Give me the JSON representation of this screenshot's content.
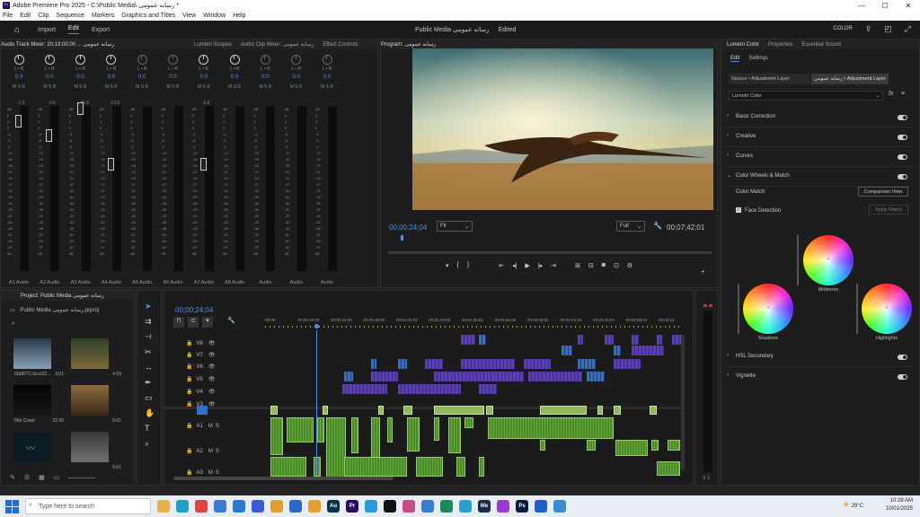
{
  "window": {
    "title": "Adobe Premiere Pro 2025 - C:\\Public Media\\ رسانه عمومی *",
    "controls": [
      "—",
      "☐",
      "✕"
    ]
  },
  "menu": [
    "File",
    "Edit",
    "Clip",
    "Sequence",
    "Markers",
    "Graphics and Titles",
    "View",
    "Window",
    "Help"
  ],
  "workspaces": {
    "import": "Import",
    "edit": "Edit",
    "export": "Export"
  },
  "project_title": "Public Media رسانه عمومی",
  "project_status": "Edited",
  "header_right": {
    "label": "COLOR"
  },
  "mixer": {
    "tabs": [
      "Audio Track Mixer: رسانه عمومی ... 00;00;13;20",
      "Lumetri Scopes",
      "Audio Clip Mixer: رسانه عمومی",
      "Effect Controls"
    ],
    "tracks": [
      {
        "label": "A1 Audio",
        "value": "0.0",
        "db": "-1.5"
      },
      {
        "label": "A2 Audio",
        "value": "0.0",
        "db": "-3.6"
      },
      {
        "label": "A3 Audio",
        "value": "0.0",
        "db": "-45.0"
      },
      {
        "label": "A4 Audio",
        "value": "0.0",
        "db": "-13.0"
      },
      {
        "label": "A5 Audio",
        "value": "0.0",
        "db": ""
      },
      {
        "label": "A6 Audio",
        "value": "0.0",
        "db": ""
      },
      {
        "label": "A7 Audio",
        "value": "0.0",
        "db": "-5.6"
      },
      {
        "label": "A8 Audio",
        "value": "0.0",
        "db": ""
      },
      {
        "label": "Audio",
        "value": "0.0",
        "db": ""
      },
      {
        "label": "Audio",
        "value": "0.0",
        "db": ""
      },
      {
        "label": "Audio",
        "value": "0.0",
        "db": ""
      }
    ],
    "scale": [
      "dB",
      "6",
      "3",
      "0",
      "-3",
      "-6",
      "-9",
      "-12",
      "-15",
      "-18",
      "-21",
      "-24",
      "-27",
      "-30",
      "-33",
      "-36",
      "-39",
      "-42",
      "-45",
      "-48",
      "-51",
      "-54",
      "-57",
      "dB"
    ]
  },
  "program": {
    "tab": "Program: رسانه عمومی",
    "current_time": "00;00;24;04",
    "fit": "Fit",
    "quality": "Full",
    "duration": "00;07;42;01"
  },
  "lumetri": {
    "tabs": [
      "Lumetri Color",
      "Properties",
      "Essential Sound"
    ],
    "subtabs": [
      "Edit",
      "Settings"
    ],
    "master": "Source • Adjustment Layer",
    "target": "رسانه عمومی • Adjustment Layer",
    "preset": "Lumetri Color",
    "sections": [
      "Basic Correction",
      "Creative",
      "Curves",
      "Color Wheels & Match",
      "HSL Secondary",
      "Vignette"
    ],
    "color_match": "Color Match",
    "comparison_view": "Comparison View",
    "face_detection": "Face Detection",
    "apply_match": "Apply Match",
    "wheels": [
      "Midtones",
      "Shadows",
      "Highlights"
    ]
  },
  "project": {
    "tab": "Project: Public Media رسانه عمومی",
    "file": "Public Media رسانه عمومی.prproj",
    "items": [
      {
        "name": "10d8071-0ccd22...",
        "dur": "3:01"
      },
      {
        "name": "",
        "dur": "4:19"
      },
      {
        "name": "Title Crawl",
        "dur": "22:30"
      },
      {
        "name": "",
        "dur": "5:01"
      },
      {
        "name": "",
        "dur": ""
      },
      {
        "name": "",
        "dur": "5:01"
      }
    ]
  },
  "timeline": {
    "timecode": "00;00;24;04",
    "ruler": [
      "00;00",
      "00;00;16;00",
      "00;00;32;00",
      "00;00;48;00",
      "00;01;04;02",
      "00;01;20;02",
      "00;01;36;02",
      "00;01;52;02",
      "00;02;08;02",
      "00;02;24;04",
      "00;02;40;04",
      "00;02;56;04",
      "00;03;12"
    ],
    "video_tracks": [
      "V8",
      "V7",
      "V6",
      "V5",
      "V4",
      "V3"
    ],
    "audio_tracks": [
      "A1",
      "A2",
      "A3"
    ]
  },
  "taskbar": {
    "search_placeholder": "Type here to search",
    "apps": [
      "Ps",
      "Ae",
      "Au",
      "Pr",
      "Lr",
      "Ai",
      "Me",
      "An"
    ],
    "weather": "29°C",
    "time": "10:28 AM",
    "date": "10/01/2025"
  },
  "colors": {
    "accent": "#4f8fe8",
    "video_clip": "#5a3fae",
    "audio_clip": "#4a8a2a",
    "timeline_bg": "#1b1b1b"
  }
}
